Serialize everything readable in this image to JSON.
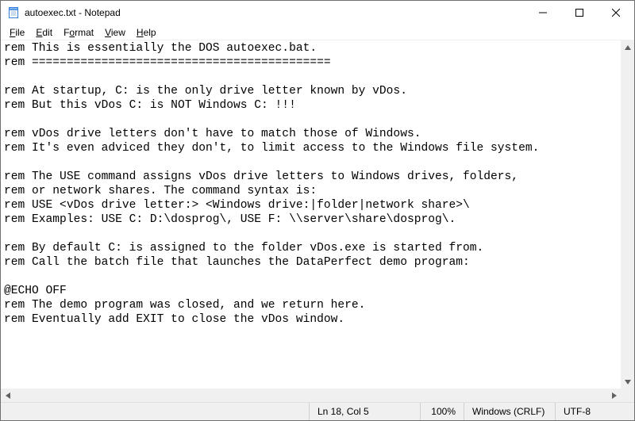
{
  "title": "autoexec.txt - Notepad",
  "menu": {
    "file": "File",
    "edit": "Edit",
    "format": "Format",
    "view": "View",
    "help": "Help"
  },
  "content": "rem This is essentially the DOS autoexec.bat.\nrem ===========================================\n\nrem At startup, C: is the only drive letter known by vDos.\nrem But this vDos C: is NOT Windows C: !!!\n\nrem vDos drive letters don't have to match those of Windows.\nrem It's even adviced they don't, to limit access to the Windows file system.\n\nrem The USE command assigns vDos drive letters to Windows drives, folders,\nrem or network shares. The command syntax is:\nrem USE <vDos drive letter:> <Windows drive:|folder|network share>\\\nrem Examples: USE C: D:\\dosprog\\, USE F: \\\\server\\share\\dosprog\\.\n\nrem By default C: is assigned to the folder vDos.exe is started from.\nrem Call the batch file that launches the DataPerfect demo program:\n\n@ECHO OFF\nrem The demo program was closed, and we return here.\nrem Eventually add EXIT to close the vDos window.",
  "status": {
    "position": "Ln 18, Col 5",
    "zoom": "100%",
    "eol": "Windows (CRLF)",
    "encoding": "UTF-8"
  }
}
